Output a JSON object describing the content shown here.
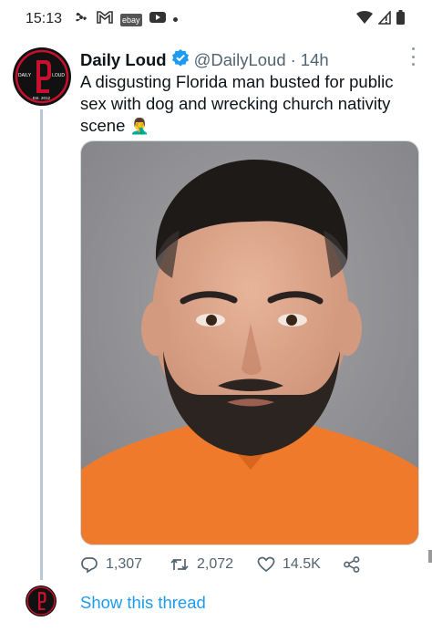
{
  "status_bar": {
    "time": "15:13",
    "ebay_label": "ebay",
    "icons": [
      "fan-icon",
      "gmail-icon",
      "ebay-icon",
      "youtube-icon",
      "notification-dot-icon",
      "wifi-icon",
      "signal-icon",
      "battery-icon"
    ]
  },
  "tweet": {
    "author_name": "Daily Loud",
    "verified": true,
    "handle": "@DailyLoud",
    "separator": "·",
    "time_ago": "14h",
    "text": "A disgusting Florida man busted for public sex with dog and wrecking church nativity scene",
    "emoji": "🤦‍♂️",
    "avatar": {
      "monogram": "DL",
      "left_text": "DAILY",
      "right_text": "LOUD",
      "est_text": "Est. 2012",
      "colors": {
        "ring": "#c8102e",
        "bg": "#111111",
        "text": "#ffffff"
      }
    },
    "media": {
      "subject": "mugshot of a man in an orange jumpsuit",
      "background_color": "#8f8f92",
      "jumpsuit_color": "#f07a2a"
    },
    "actions": {
      "replies": "1,307",
      "retweets": "2,072",
      "likes": "14.5K"
    }
  },
  "thread": {
    "show_thread_label": "Show this thread"
  },
  "colors": {
    "link_blue": "#1d9bf0",
    "muted": "#536471",
    "thread_line": "#b7c9d6"
  }
}
